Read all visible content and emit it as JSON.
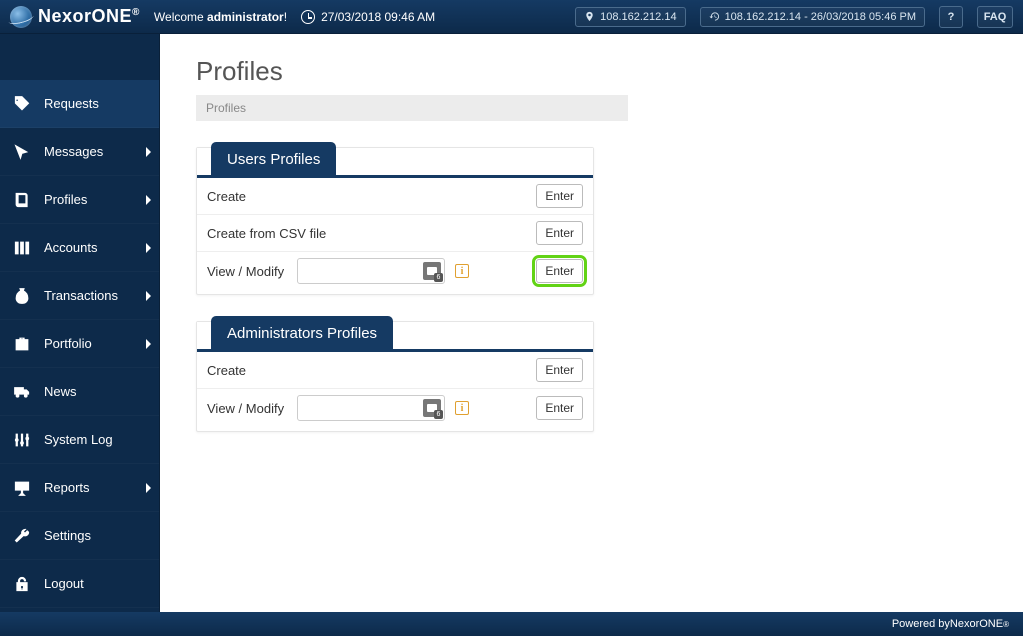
{
  "brand": {
    "name": "NexorONE",
    "reg": "®"
  },
  "header": {
    "welcome_prefix": "Welcome ",
    "welcome_user": "administrator",
    "welcome_suffix": "!",
    "datetime": "27/03/2018 09:46 AM",
    "ip_current": "108.162.212.14",
    "ip_history": "108.162.212.14 - 26/03/2018 05:46 PM",
    "help_label": "?",
    "faq_label": "FAQ"
  },
  "sidebar": {
    "items": [
      {
        "label": "Requests",
        "icon": "tag",
        "expandable": false,
        "active": true
      },
      {
        "label": "Messages",
        "icon": "cursor",
        "expandable": true
      },
      {
        "label": "Profiles",
        "icon": "book",
        "expandable": true
      },
      {
        "label": "Accounts",
        "icon": "columns",
        "expandable": true
      },
      {
        "label": "Transactions",
        "icon": "moneybag",
        "expandable": true
      },
      {
        "label": "Portfolio",
        "icon": "briefcase",
        "expandable": true
      },
      {
        "label": "News",
        "icon": "truck",
        "expandable": false
      },
      {
        "label": "System Log",
        "icon": "sliders",
        "expandable": false
      },
      {
        "label": "Reports",
        "icon": "presentation",
        "expandable": true
      },
      {
        "label": "Settings",
        "icon": "wrench",
        "expandable": false
      },
      {
        "label": "Logout",
        "icon": "lock",
        "expandable": false
      }
    ]
  },
  "page": {
    "title": "Profiles",
    "breadcrumb": "Profiles"
  },
  "panels": {
    "users": {
      "tab": "Users Profiles",
      "rows": {
        "create_label": "Create",
        "create_csv_label": "Create from CSV file",
        "view_label": "View / Modify"
      }
    },
    "admins": {
      "tab": "Administrators Profiles",
      "rows": {
        "create_label": "Create",
        "view_label": "View / Modify"
      }
    }
  },
  "buttons": {
    "enter": "Enter"
  },
  "footer": {
    "powered_prefix": "Powered by ",
    "powered_brand": "NexorONE",
    "reg": "®"
  }
}
